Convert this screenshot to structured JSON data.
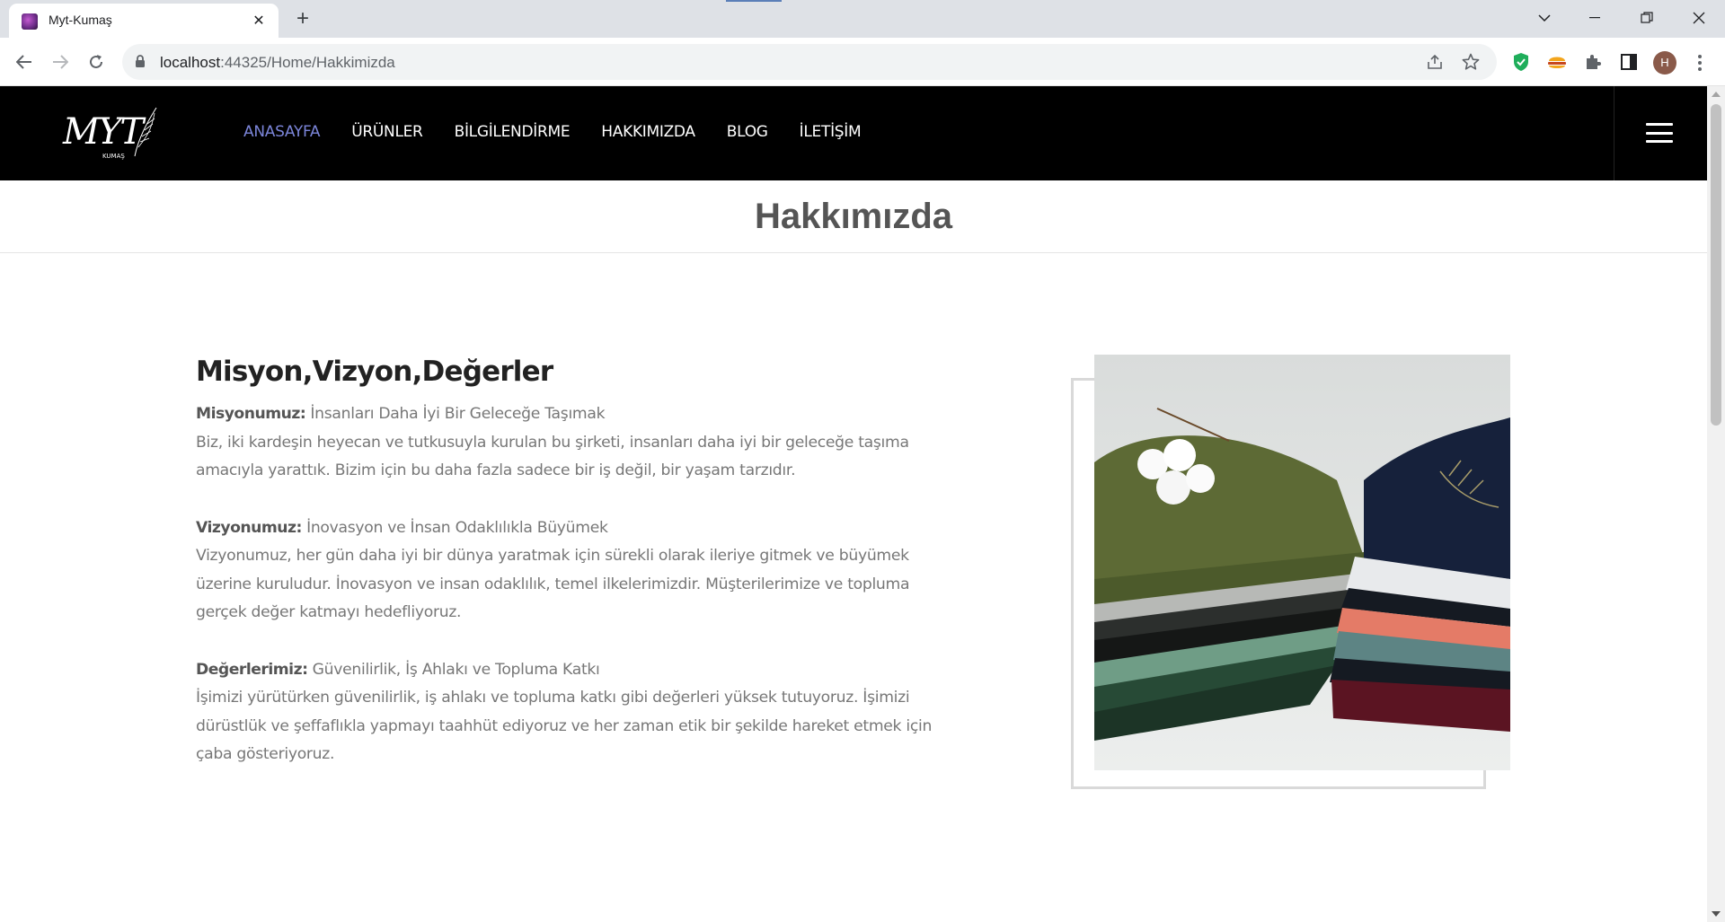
{
  "browser": {
    "tab_title": "Myt-Kumaş",
    "url_host": "localhost",
    "url_rest": ":44325/Home/Hakkimizda",
    "avatar_letter": "H"
  },
  "site": {
    "logo_text": "MYT",
    "logo_sub": "KUMAŞ",
    "nav": [
      {
        "label": "ANASAYFA",
        "active": true
      },
      {
        "label": "ÜRÜNLER",
        "active": false
      },
      {
        "label": "BİLGİLENDİRME",
        "active": false
      },
      {
        "label": "HAKKIMIZDA",
        "active": false
      },
      {
        "label": "BLOG",
        "active": false
      },
      {
        "label": "İLETİŞİM",
        "active": false
      }
    ],
    "accent_color": "#7b85d9"
  },
  "page": {
    "title": "Hakkımızda",
    "heading": "Misyon,Vizyon,Değerler",
    "mission_label": "Misyonumuz:",
    "mission_title": " İnsanları Daha İyi Bir Geleceğe Taşımak",
    "mission_text": "Biz, iki kardeşin heyecan ve tutkusuyla kurulan bu şirketi, insanları daha iyi bir geleceğe taşıma amacıyla yarattık. Bizim için bu daha fazla sadece bir iş değil, bir yaşam tarzıdır.",
    "vision_label": "Vizyonumuz:",
    "vision_title": " İnovasyon ve İnsan Odaklılıkla Büyümek",
    "vision_text": "Vizyonumuz, her gün daha iyi bir dünya yaratmak için sürekli olarak ileriye gitmek ve büyümek üzerine kuruludur. İnovasyon ve insan odaklılık, temel ilkelerimizdir. Müşterilerimize ve topluma gerçek değer katmayı hedefliyoruz.",
    "values_label": "Değerlerimiz:",
    "values_title": " Güvenilirlik, İş Ahlakı ve Topluma Katkı",
    "values_text": "İşimizi yürütürken güvenilirlik, iş ahlakı ve topluma katkı gibi değerleri yüksek tutuyoruz. İşimizi dürüstlük ve şeffaflıkla yapmayı taahhüt ediyoruz ve her zaman etik bir şekilde hareket etmek için çaba gösteriyoruz."
  }
}
